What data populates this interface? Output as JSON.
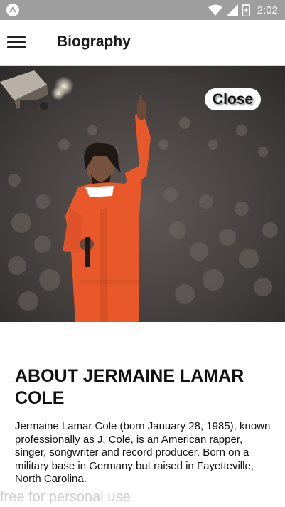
{
  "status_bar": {
    "time": "2:02",
    "icons": [
      "app-badge-icon",
      "wifi-icon",
      "signal-icon",
      "battery-icon"
    ]
  },
  "app_bar": {
    "title": "Biography",
    "menu_icon": "hamburger-menu-icon"
  },
  "hero": {
    "close_label": "Close",
    "image_description_icon": "artist-photo"
  },
  "content": {
    "heading": "ABOUT JERMAINE LAMAR COLE",
    "body": "Jermaine Lamar Cole (born January 28, 1985), known professionally as J. Cole, is an American rapper, singer, songwriter and record producer. Born on a military base in Germany but raised in Fayetteville, North Carolina."
  },
  "watermark": "free for personal use",
  "colors": {
    "status_bar": "#9e9e9e",
    "jumpsuit": "#e8582a",
    "text": "#111111"
  }
}
